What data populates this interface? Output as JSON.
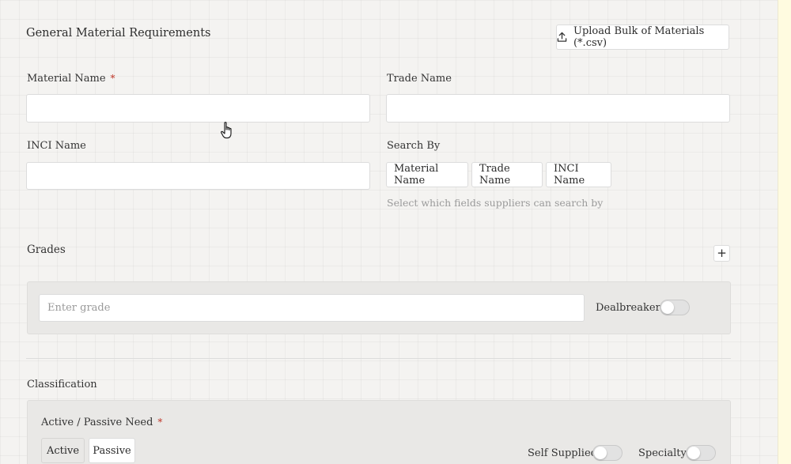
{
  "general": {
    "title": "General Material Requirements",
    "upload_label": "Upload Bulk of Materials (*.csv)"
  },
  "fields": {
    "material_name_label": "Material Name",
    "required_mark": "*",
    "material_name_value": "",
    "trade_name_label": "Trade Name",
    "trade_name_value": "",
    "inci_name_label": "INCI Name",
    "inci_name_value": ""
  },
  "search_by": {
    "label": "Search By",
    "options": [
      "Material Name",
      "Trade Name",
      "INCI Name"
    ],
    "hint": "Select which fields suppliers can search by"
  },
  "grades": {
    "title": "Grades",
    "add_label": "+",
    "grade_placeholder": "Enter grade",
    "dealbreaker_label": "Dealbreaker"
  },
  "classification": {
    "title": "Classification",
    "need_label": "Active / Passive Need",
    "required_mark": "*",
    "need_options": [
      "Active",
      "Passive"
    ],
    "self_supplied_label": "Self Supplied",
    "specialty_label": "Specialty"
  },
  "icons": {
    "upload": "upload-icon",
    "cursor": "hand-pointer-icon"
  },
  "colors": {
    "required": "#c0392b",
    "hint": "#9a9a9a"
  }
}
